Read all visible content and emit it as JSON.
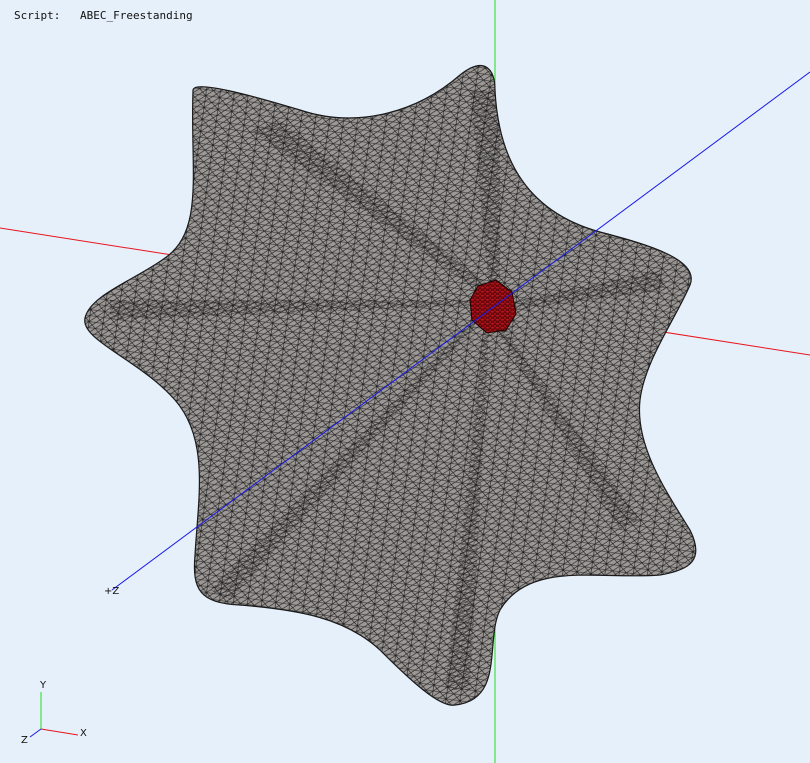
{
  "viewer": {
    "script_key": "Script:",
    "script_value": "ABEC_Freestanding",
    "z_axis_tag": "+Z",
    "background": "#e6f0fa",
    "mesh_fill": "#9c9896",
    "mesh_line": "#1a1a1a",
    "throat_fill": "#c0141c",
    "axis_colors": {
      "x": "#e8141c",
      "y": "#22dd22",
      "z": "#1a1ae8"
    }
  },
  "triad": {
    "x_label": "X",
    "y_label": "Y",
    "z_label": "Z"
  }
}
